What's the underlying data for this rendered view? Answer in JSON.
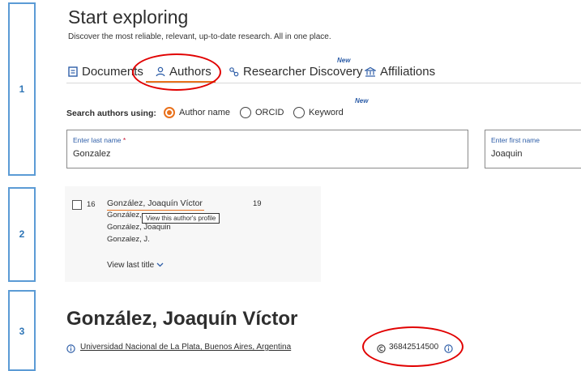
{
  "header": {
    "title": "Start exploring",
    "subtitle": "Discover the most reliable, relevant, up-to-date research. All in one place."
  },
  "tabs": [
    {
      "label": "Documents",
      "icon": "document-icon"
    },
    {
      "label": "Authors",
      "icon": "person-icon",
      "active": true
    },
    {
      "label": "Researcher Discovery",
      "icon": "researcher-icon",
      "badge": "New"
    },
    {
      "label": "Affiliations",
      "icon": "building-icon"
    }
  ],
  "search_using": {
    "label": "Search authors using:",
    "options": [
      "Author name",
      "ORCID",
      "Keyword"
    ],
    "selected": "Author name",
    "keyword_badge": "New"
  },
  "fields": {
    "last_name": {
      "label": "Enter last name",
      "required_mark": "*",
      "value": "Gonzalez"
    },
    "first_name": {
      "label": "Enter first name",
      "value": "Joaquin"
    }
  },
  "result": {
    "index": "16",
    "name": "González, Joaquín Víctor",
    "documents": "19",
    "variants": [
      "González,",
      "González, Joaquin",
      "Gonzalez, J."
    ],
    "tooltip": "View this author's profile",
    "view_last_title": "View last title"
  },
  "profile": {
    "name": "González, Joaquín Víctor",
    "affiliation": "Universidad Nacional de La Plata, Buenos Aires, Argentina",
    "author_id": "36842514500"
  },
  "steps": [
    "1",
    "2",
    "3"
  ],
  "colors": {
    "accent": "#e9711c",
    "annotation": "#e10000",
    "step_border": "#5b9bd5",
    "link_blue": "#2e5ea8"
  }
}
